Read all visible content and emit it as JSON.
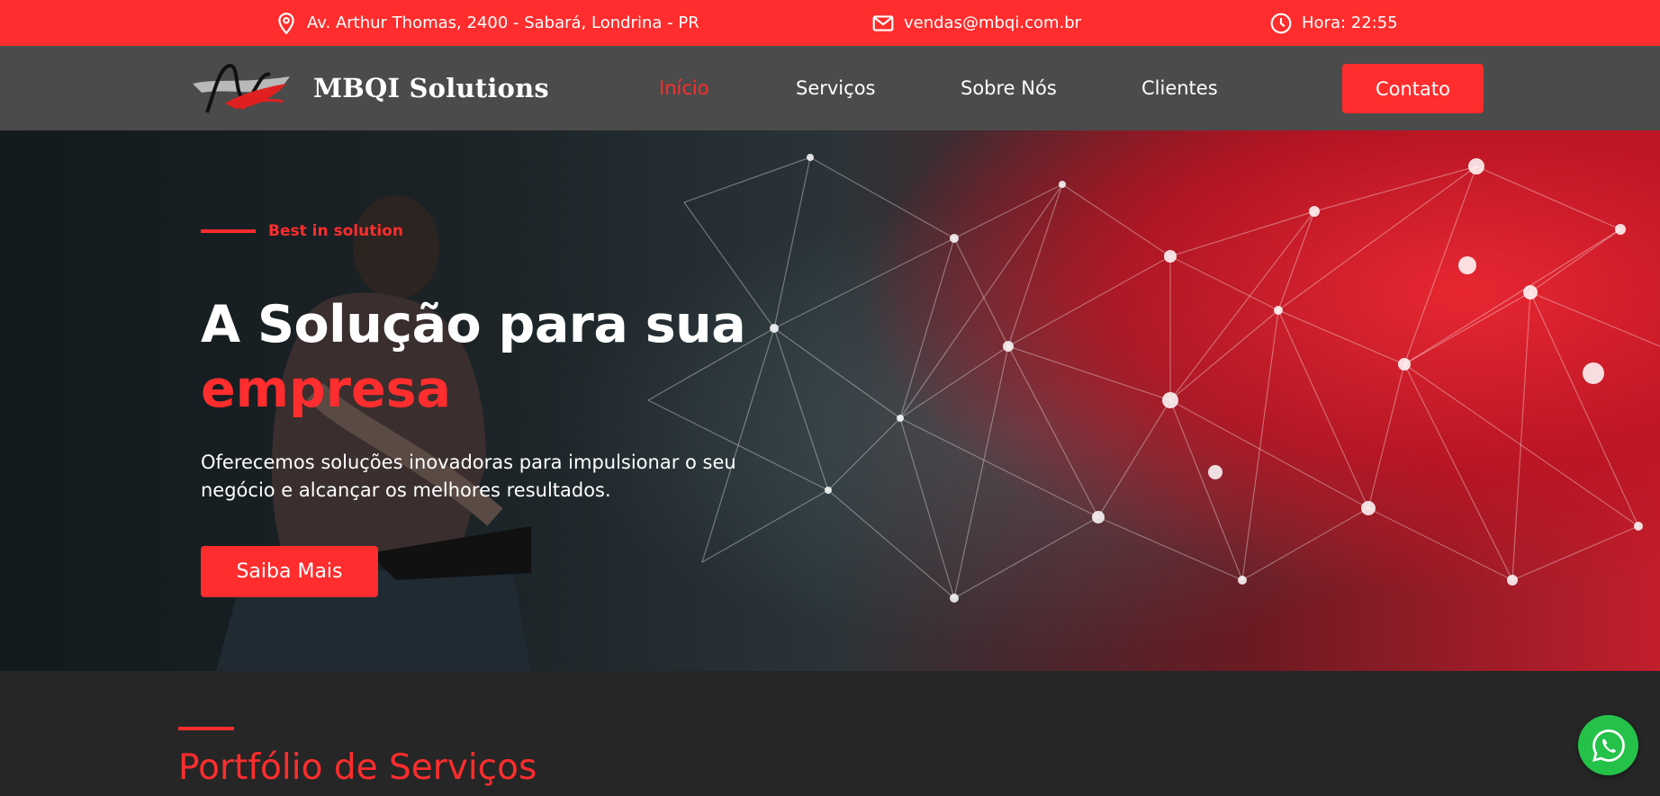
{
  "topbar": {
    "address": "Av. Arthur Thomas, 2400 - Sabará, Londrina - PR",
    "email": "vendas@mbqi.com.br",
    "time": "Hora: 22:55",
    "icons": {
      "address": "map-pin-icon",
      "email": "mail-icon",
      "time": "clock-icon"
    }
  },
  "nav": {
    "logo_text": "MBQI Solutions",
    "links": [
      {
        "label": "Início",
        "active": true
      },
      {
        "label": "Serviços",
        "active": false
      },
      {
        "label": "Sobre Nós",
        "active": false
      },
      {
        "label": "Clientes",
        "active": false
      }
    ],
    "contact_label": "Contato"
  },
  "hero": {
    "eyebrow": "Best in solution",
    "title": "A Solução para sua",
    "title_accent": "empresa",
    "description": "Oferecemos soluções inovadoras para impulsionar o seu negócio e alcançar os melhores resultados.",
    "button_label": "Saiba Mais"
  },
  "portfolio": {
    "title": "Portfólio de Serviços"
  },
  "colors": {
    "accent": "#ff2d2d",
    "nav_bg": "#4b4b4b",
    "page_bg": "#262626",
    "whatsapp": "#25c24a"
  }
}
